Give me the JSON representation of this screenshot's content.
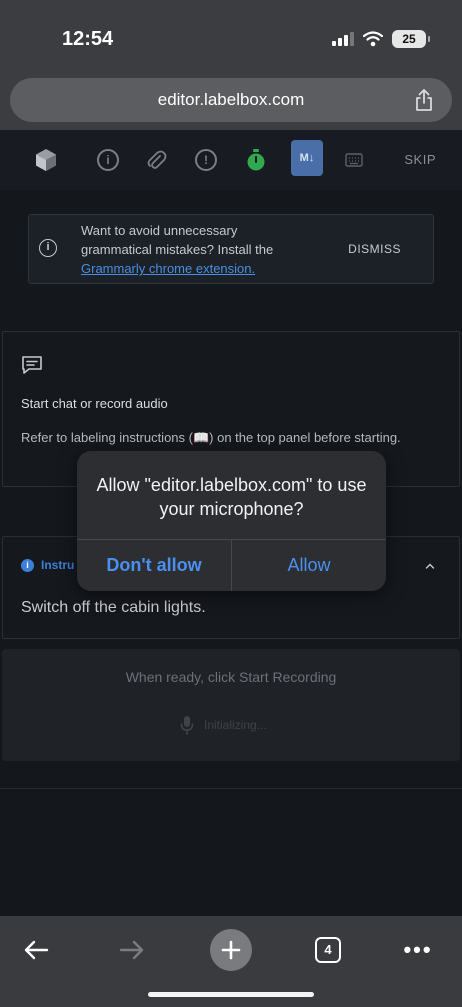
{
  "status_bar": {
    "time": "12:54",
    "battery": "25"
  },
  "browser": {
    "url": "editor.labelbox.com"
  },
  "toolbar": {
    "skip_label": "SKIP",
    "info_glyph": "i",
    "alert_glyph": "!",
    "md_label": "M↓"
  },
  "banner": {
    "text": "Want to avoid unnecessary grammatical mistakes? Install the",
    "link": "Grammarly chrome extension.",
    "dismiss": "DISMISS"
  },
  "chat_card": {
    "title": "Start chat or record audio",
    "description": "Refer to labeling instructions (📖) on the top panel before starting."
  },
  "instruction": {
    "label": "Instru",
    "text": "Switch off the cabin lights."
  },
  "recording": {
    "hint": "When ready, click Start Recording",
    "status": "Initializing..."
  },
  "dialog": {
    "title": "Allow \"editor.labelbox.com\" to use your microphone?",
    "deny": "Don't allow",
    "allow": "Allow"
  },
  "bottom_bar": {
    "tab_count": "4",
    "more": "•••"
  },
  "colors": {
    "accent": "#4a90f0",
    "instruction_blue": "#3d7fd6",
    "timer_green": "#2fa84f"
  }
}
